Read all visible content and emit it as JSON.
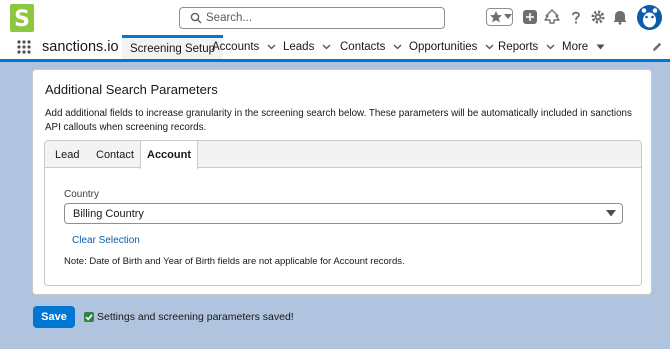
{
  "header": {
    "logo_icon": "sanctions-logo-icon",
    "search": {
      "placeholder": "Search..."
    },
    "icons": [
      "star-icon",
      "plus-icon",
      "trailhead-icon",
      "help-icon",
      "gear-icon",
      "bell-icon",
      "avatar-icon"
    ]
  },
  "nav": {
    "app_name": "sanctions.io",
    "items": [
      {
        "label": "Screening Setup",
        "active": true
      },
      {
        "label": "Accounts"
      },
      {
        "label": "Leads"
      },
      {
        "label": "Contacts"
      },
      {
        "label": "Opportunities"
      },
      {
        "label": "Reports"
      },
      {
        "label": "More"
      }
    ]
  },
  "card": {
    "title": "Additional Search Parameters",
    "description": "Add additional fields to increase granularity in the screening search below. These parameters will be automatically included in sanctions API callouts when screening records.",
    "tabs": [
      {
        "label": "Lead"
      },
      {
        "label": "Contact"
      },
      {
        "label": "Account",
        "active": true
      }
    ],
    "field": {
      "label": "Country",
      "value": "Billing Country"
    },
    "clear_link": "Clear Selection",
    "note": "Note: Date of Birth and Year of Birth fields are not applicable for Account records."
  },
  "footer": {
    "save_label": "Save",
    "status_text": "Settings and screening parameters saved!"
  },
  "colors": {
    "brand_blue": "#0176d3",
    "background": "#b0c4df",
    "success_green": "#2e844a",
    "logo_green": "#8dc63f"
  }
}
